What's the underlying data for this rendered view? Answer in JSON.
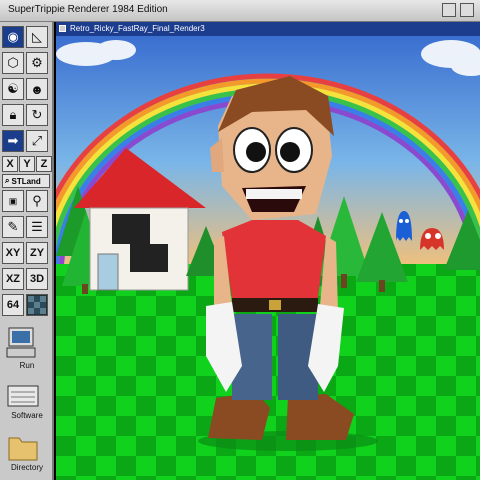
{
  "window": {
    "title": "SuperTrippie Renderer 1984 Edition"
  },
  "viewport": {
    "tab_title": "Retro_Ricky_FastRay_Final_Render3"
  },
  "toolbar": {
    "axis_x": "X",
    "axis_y": "Y",
    "axis_z": "Z",
    "stl_land": "STLand",
    "view_xy": "XY",
    "view_zy": "ZY",
    "view_xz": "XZ",
    "view_3d": "3D",
    "bits_64": "64"
  },
  "desktop": {
    "run_label": "Run",
    "software_label": "Software",
    "directory_label": "Directory"
  },
  "icons": [
    "eye-icon",
    "triangle-ruler-icon",
    "cube-icon",
    "gear-icon",
    "yin-yang-icon",
    "theater-masks-icon",
    "lock-icon",
    "redo-icon",
    "arrow-right-icon",
    "resize-icon",
    "magnifier-icon",
    "feather-icon",
    "stack-icon",
    "checker-icon",
    "computer-icon",
    "keyboard-icon",
    "folder-icon"
  ],
  "colors": {
    "accent": "#1c3c8e",
    "sky_top": "#3a6fd0",
    "grass": "#12d81e"
  }
}
